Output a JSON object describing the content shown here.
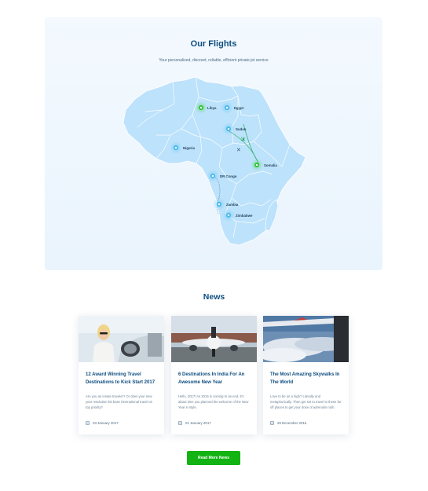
{
  "flights": {
    "title": "Our Flights",
    "subtitle": "Your personalized, discreet, reliable, efficient private jet service",
    "map_color": "#bde2fb",
    "pin_color_blue": "#3fb6ec",
    "pin_color_green": "#22c322",
    "cities": [
      {
        "name": "Libya",
        "status": "green"
      },
      {
        "name": "Egypt",
        "status": "blue"
      },
      {
        "name": "Sudan",
        "status": "blue"
      },
      {
        "name": "Nigeria",
        "status": "blue"
      },
      {
        "name": "Somalia",
        "status": "green"
      },
      {
        "name": "DR Congo",
        "status": "blue"
      },
      {
        "name": "Zambia",
        "status": "blue"
      },
      {
        "name": "Zimbabwe",
        "status": "blue"
      }
    ]
  },
  "news": {
    "title": "News",
    "cards": [
      {
        "title": "12 Award Winning Travel Destinations to Kick Start 2017",
        "excerpt": "Are you an innate traveler? Or does your new year resolution list base international travel on top priority?",
        "date": "03 January 2017",
        "image": "woman-with-sunglasses-at-aircraft"
      },
      {
        "title": "6 Destinations In India For An Awesome New Year",
        "excerpt": "Hello, 2017! As 2016 is coming to an end, it's about time you planned the welcome of the New Year in style.",
        "date": "01 January 2017",
        "image": "jet-on-runway"
      },
      {
        "title": "The Most Amazing Skywalks In The World",
        "excerpt": "Love to be on a high? Literally and metaphorically. Then get set to travel to these far off places to get your dose of adrenalin rush.",
        "date": "26 December 2016",
        "image": "clouds-from-plane-window"
      }
    ],
    "read_more_label": "Read More News",
    "read_more_color": "#12b312"
  }
}
